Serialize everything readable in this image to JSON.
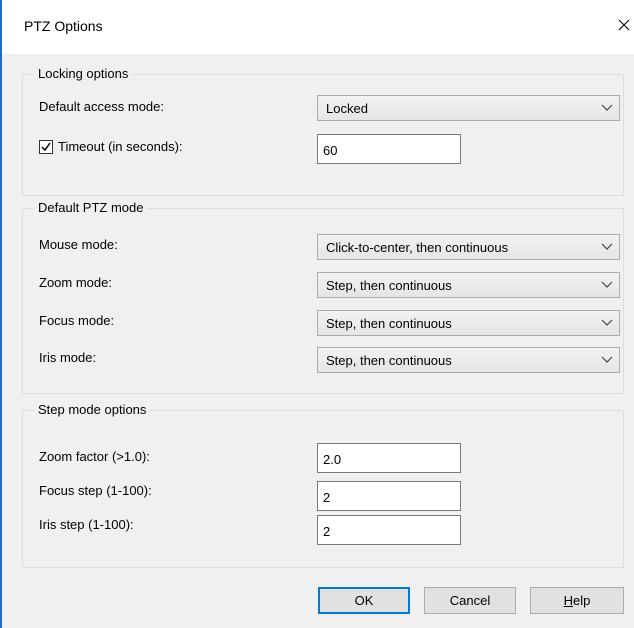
{
  "dialog": {
    "title": "PTZ Options"
  },
  "icons": {
    "close": "close-icon",
    "dropdown": "chevron-down-icon",
    "check": "checkmark-icon"
  },
  "locking": {
    "title": "Locking options",
    "access_mode_label": "Default access mode:",
    "access_mode_value": "Locked",
    "timeout_label": "Timeout (in seconds):",
    "timeout_checked": true,
    "timeout_value": "60"
  },
  "ptz": {
    "title": "Default PTZ mode",
    "mouse_label": "Mouse mode:",
    "mouse_value": "Click-to-center, then continuous",
    "zoom_label": "Zoom mode:",
    "zoom_value": "Step, then continuous",
    "focus_label": "Focus mode:",
    "focus_value": "Step, then continuous",
    "iris_label": "Iris mode:",
    "iris_value": "Step, then continuous"
  },
  "step": {
    "title": "Step mode options",
    "zoom_factor_label": "Zoom factor (>1.0):",
    "zoom_factor_value": "2.0",
    "focus_step_label": "Focus step (1-100):",
    "focus_step_value": "2",
    "iris_step_label": "Iris step (1-100):",
    "iris_step_value": "2"
  },
  "buttons": {
    "ok": "OK",
    "cancel": "Cancel",
    "help_mnemonic": "H",
    "help_rest": "elp"
  }
}
